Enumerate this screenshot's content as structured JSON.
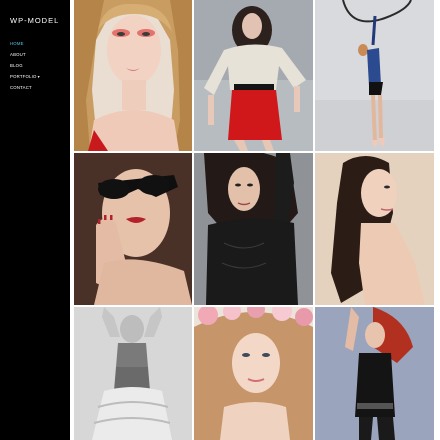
{
  "site": {
    "title": "WP-MODEL"
  },
  "nav": {
    "items": [
      {
        "label": "HOME",
        "active": true
      },
      {
        "label": "ABOUT",
        "active": false
      },
      {
        "label": "BLOG",
        "active": false
      },
      {
        "label": "PORTFOLIO",
        "active": false,
        "has_submenu": true
      },
      {
        "label": "CONTACT",
        "active": false
      }
    ],
    "submenu_icon": "chevron-down-icon"
  },
  "colors": {
    "sidebar_bg": "#000000",
    "nav_text": "#ffffff",
    "nav_active": "#5bc8e6"
  },
  "gallery": {
    "photos": [
      {
        "subject": "blonde model with red eye makeup"
      },
      {
        "subject": "model in white blouse and red skirt"
      },
      {
        "subject": "aerial hoop dancer"
      },
      {
        "subject": "model with sunglasses and red lips"
      },
      {
        "subject": "model in black lace top"
      },
      {
        "subject": "model with long straight hair"
      },
      {
        "subject": "model in tulle skirt"
      },
      {
        "subject": "model with flower crown"
      },
      {
        "subject": "model with red hair in black outfit"
      }
    ]
  }
}
